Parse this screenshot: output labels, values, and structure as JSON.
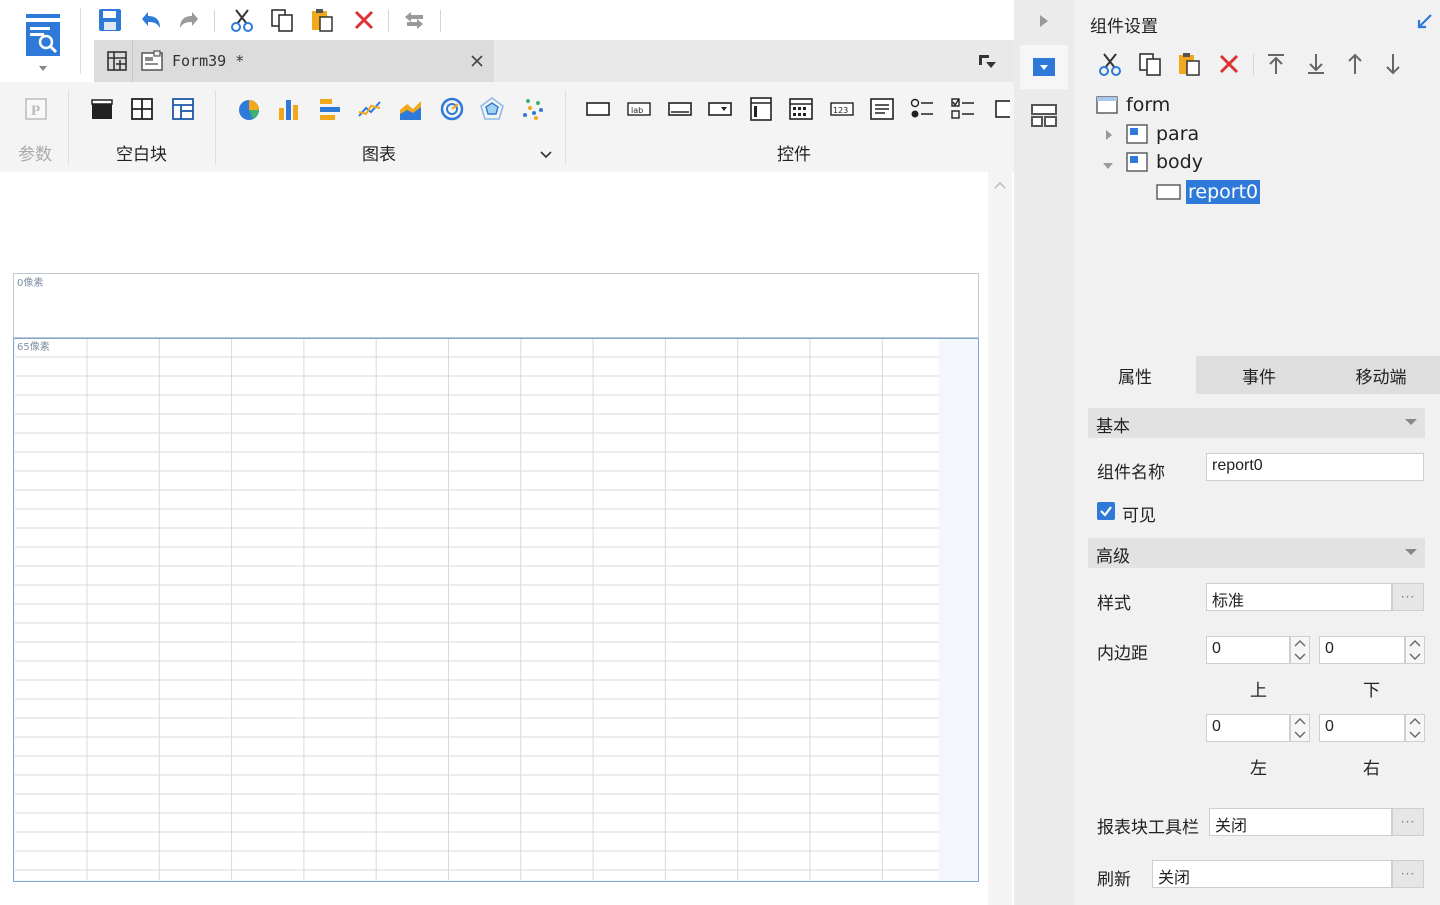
{
  "toolbar": {
    "buttons": [
      "save",
      "undo",
      "redo",
      "cut",
      "copy",
      "paste",
      "delete",
      "swap"
    ]
  },
  "tab": {
    "title": "Form39 *"
  },
  "ribbon": {
    "groups": {
      "params": "参数",
      "blank": "空白块",
      "chart": "图表",
      "controls": "控件"
    }
  },
  "canvas": {
    "para_label": "0像素",
    "body_label": "65像素"
  },
  "right_panel": {
    "title": "组件设置",
    "tree": {
      "form": "form",
      "para": "para",
      "body": "body",
      "report": "report0"
    },
    "tabs": [
      "属性",
      "事件",
      "移动端"
    ],
    "sections": {
      "basic": "基本",
      "advanced": "高级"
    },
    "fields": {
      "name_label": "组件名称",
      "name_value": "report0",
      "visible_label": "可见",
      "style_label": "样式",
      "style_value": "标准",
      "padding_label": "内边距",
      "padding_top": "0",
      "padding_bottom": "0",
      "padding_left": "0",
      "padding_right": "0",
      "top_label": "上",
      "bottom_label": "下",
      "left_label": "左",
      "right_label": "右",
      "toolbar_label": "报表块工具栏",
      "toolbar_value": "关闭",
      "refresh_label": "刷新",
      "refresh_value": "关闭"
    },
    "dots": "···"
  },
  "colors": {
    "accent": "#2f7ad9",
    "delete_red": "#e03232",
    "selection": "#2f7ad9"
  }
}
